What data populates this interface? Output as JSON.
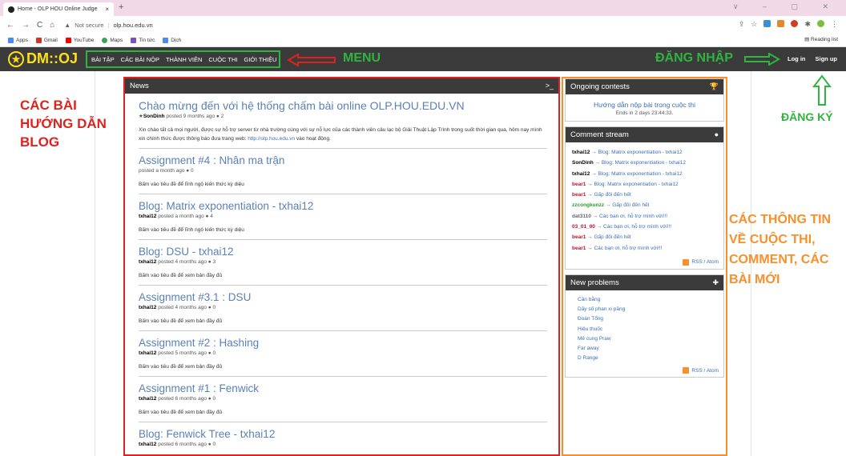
{
  "browser": {
    "tab_title": "Home - OLP HOU Online Judge",
    "tab_close": "×",
    "new_tab": "+",
    "window_controls": "∨ – ▢ ✕",
    "security_label": "Not secure",
    "url": "olp.hou.edu.vn",
    "bookmarks": [
      "Apps",
      "Gmail",
      "YouTube",
      "Maps",
      "Tin tức",
      "Dịch"
    ],
    "reading_list": "Reading list"
  },
  "site": {
    "logo_text": "DM::OJ",
    "menu": [
      "BÀI TẬP",
      "CÁC BÀI NỘP",
      "THÀNH VIÊN",
      "CUỘC THI",
      "GIỚI THIỆU"
    ],
    "login": "Log in",
    "signup": "Sign up"
  },
  "annotations": {
    "menu": "MENU",
    "login": "ĐĂNG NHẬP",
    "register": "ĐĂNG KÝ",
    "blog": "CÁC BÀI HƯỚNG DẪN BLOG",
    "contest": "CÁC THÔNG TIN VỀ CUỘC THI, COMMENT, CÁC BÀI MỚI"
  },
  "news": {
    "header": "News",
    "header_icon": ">_",
    "posts": [
      {
        "title": "Chào mừng đến với hệ thống chấm bài online OLP.HOU.EDU.VN",
        "author": "SonDinh",
        "meta": "posted 9 months ago",
        "comments": "2",
        "body": "Xin chào tất cả mọi người, được sự hỗ trợ server từ nhà trường cùng với sự nỗ lực của các thành viên câu lạc bộ Giải Thuật Lập Trình trong suốt thời gian qua, hôm nay mình xin chính thức được thông báo đưa trang web: ",
        "body_link": "http://olp.hou.edu.vn",
        "body_end": " vào hoạt động."
      },
      {
        "title": "Assignment #4 : Nhân ma trận",
        "author": "",
        "meta": "posted a month ago",
        "comments": "0",
        "body": "Bấm vào tiêu đề để lĩnh ngộ kiến thức kỳ diệu"
      },
      {
        "title": "Blog: Matrix exponentiation - txhai12",
        "author": "txhai12",
        "meta": "posted a month ago",
        "comments": "4",
        "body": "Bấm vào tiêu đề để lĩnh ngộ kiến thức kỳ diệu"
      },
      {
        "title": "Blog: DSU - txhai12",
        "author": "txhai12",
        "meta": "posted 4 months ago",
        "comments": "3",
        "body": "Bấm vào tiêu đề để xem bản đầy đủ"
      },
      {
        "title": "Assignment #3.1 : DSU",
        "author": "txhai12",
        "meta": "posted 4 months ago",
        "comments": "0",
        "body": "Bấm vào tiêu đề để xem bản đầy đủ"
      },
      {
        "title": "Assignment #2 : Hashing",
        "author": "txhai12",
        "meta": "posted 5 months ago",
        "comments": "0",
        "body": "Bấm vào tiêu đề để xem bản đầy đủ"
      },
      {
        "title": "Assignment #1 : Fenwick",
        "author": "txhai12",
        "meta": "posted 6 months ago",
        "comments": "0",
        "body": "Bấm vào tiêu đề để xem bản đầy đủ"
      },
      {
        "title": "Blog: Fenwick Tree - txhai12",
        "author": "txhai12",
        "meta": "posted 6 months ago",
        "comments": "0",
        "body": ""
      }
    ]
  },
  "ongoing": {
    "header": "Ongoing contests",
    "contest_name": "Hướng dẫn nộp bài trong cuộc thi",
    "contest_time": "Ends in 2 days 23:44:33."
  },
  "comment_stream": {
    "header": "Comment stream",
    "items": [
      {
        "user": "txhai12",
        "color": "#000000",
        "target": "Blog: Matrix exponentiation - txhai12"
      },
      {
        "user": "SonDinh",
        "color": "#000000",
        "target": "Blog: Matrix exponentiation - txhai12"
      },
      {
        "user": "txhai12",
        "color": "#000000",
        "target": "Blog: Matrix exponentiation - txhai12"
      },
      {
        "user": "bear1",
        "color": "#b8132a",
        "target": "Blog: Matrix exponentiation - txhai12"
      },
      {
        "user": "bear1",
        "color": "#b8132a",
        "target": "Gấp đôi đến hết"
      },
      {
        "user": "zzcongkunzz",
        "color": "#2a9b2a",
        "target": "Gấp đôi đến hết"
      },
      {
        "user": "dat3110",
        "color": "#666666",
        "target": "Các bạn ơi, hỗ trợ mình với!!!"
      },
      {
        "user": "03_01_00",
        "color": "#b8132a",
        "target": "Các bạn ơi, hỗ trợ mình với!!!"
      },
      {
        "user": "bear1",
        "color": "#b8132a",
        "target": "Gấp đôi đến hết"
      },
      {
        "user": "bear1",
        "color": "#b8132a",
        "target": "Các bạn ơi, hỗ trợ mình với!!!"
      }
    ],
    "rss": "RSS / Atom"
  },
  "new_problems": {
    "header": "New problems",
    "items": [
      "Cân bằng",
      "Dãy số phan xi păng",
      "Đoán Tổng",
      "Hiệu thuốc",
      "Mê cung Praw",
      "Far away",
      "D Range"
    ],
    "rss": "RSS / Atom"
  }
}
